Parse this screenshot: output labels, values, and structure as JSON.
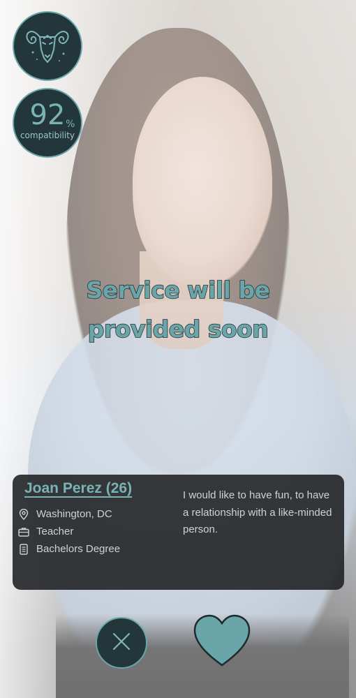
{
  "compatibility": {
    "value": "92",
    "unit": "%",
    "label": "compatibility"
  },
  "zodiac": {
    "icon": "aries-ram-icon"
  },
  "notice": {
    "line1": "Service will be",
    "line2": "provided soon"
  },
  "profile": {
    "name": "Joan Perez (26)",
    "location": "Washington, DC",
    "occupation": "Teacher",
    "education": "Bachelors Degree",
    "bio": "I would like to have fun, to have a relationship with a like-minded person."
  },
  "actions": {
    "reject_icon": "close-icon",
    "like_icon": "heart-icon"
  },
  "colors": {
    "accent": "#6aa6a9",
    "badge_bg": "#23363a",
    "card_bg": "#1e1f21"
  }
}
